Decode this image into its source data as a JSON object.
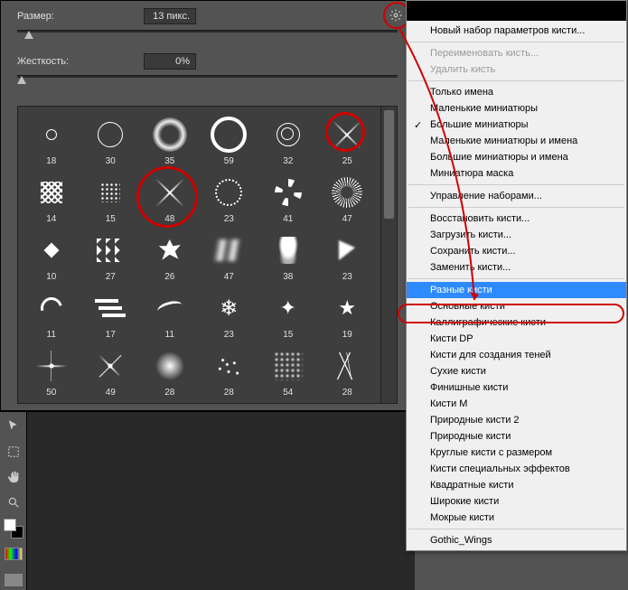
{
  "controls": {
    "size_label": "Размер:",
    "size_value": "13 пикс.",
    "hardness_label": "Жесткость:",
    "hardness_value": "0%"
  },
  "brushes": [
    {
      "n": "18",
      "t": "ring-s"
    },
    {
      "n": "30",
      "t": "ring-m"
    },
    {
      "n": "35",
      "t": "soft-ring"
    },
    {
      "n": "59",
      "t": "ring-thick"
    },
    {
      "n": "32",
      "t": "ring-double"
    },
    {
      "n": "25",
      "t": "cross"
    },
    {
      "n": "14",
      "t": "hatch"
    },
    {
      "n": "15",
      "t": "grid"
    },
    {
      "n": "48",
      "t": "cross"
    },
    {
      "n": "23",
      "t": "dotted-ring"
    },
    {
      "n": "41",
      "t": "swirl"
    },
    {
      "n": "47",
      "t": "burst"
    },
    {
      "n": "10",
      "t": "diamond"
    },
    {
      "n": "27",
      "t": "zigzag"
    },
    {
      "n": "26",
      "t": "splat"
    },
    {
      "n": "47",
      "t": "blur-z"
    },
    {
      "n": "38",
      "t": "blob"
    },
    {
      "n": "23",
      "t": "tri"
    },
    {
      "n": "11",
      "t": "curl"
    },
    {
      "n": "17",
      "t": "dash3"
    },
    {
      "n": "11",
      "t": "squig"
    },
    {
      "n": "23",
      "t": "snow"
    },
    {
      "n": "15",
      "t": "star"
    },
    {
      "n": "19",
      "t": "star5"
    },
    {
      "n": "50",
      "t": "sparkle"
    },
    {
      "n": "49",
      "t": "sparkle-d"
    },
    {
      "n": "28",
      "t": "fuzz"
    },
    {
      "n": "28",
      "t": "grain"
    },
    {
      "n": "54",
      "t": "dust"
    },
    {
      "n": "28",
      "t": "scratch"
    }
  ],
  "menu": {
    "new_preset": "Новый набор параметров кисти...",
    "rename": "Переименовать кисть...",
    "delete": "Удалить кисть",
    "names_only": "Только имена",
    "small_thumb": "Маленькие миниатюры",
    "large_thumb": "Большие миниатюры",
    "small_thumb_names": "Маленькие миниатюры и имена",
    "large_thumb_names": "Большие миниатюры и имена",
    "mask_thumb": "Миниатюра маска",
    "preset_manager": "Управление наборами...",
    "restore": "Восстановить кисти...",
    "load": "Загрузить кисти...",
    "save": "Сохранить кисти...",
    "replace": "Заменить кисти...",
    "assorted": "Разные кисти",
    "basic": "Основные кисти",
    "calligraphic": "Каллиграфические кисти",
    "dp": "Кисти DP",
    "shadow": "Кисти для создания теней",
    "dry": "Сухие кисти",
    "finish": "Финишные кисти",
    "m": "Кисти M",
    "natural2": "Природные кисти 2",
    "natural": "Природные кисти",
    "round_size": "Круглые кисти с размером",
    "special": "Кисти специальных эффектов",
    "square": "Квадратные кисти",
    "wide": "Широкие кисти",
    "wet": "Мокрые кисти",
    "gothic": "Gothic_Wings"
  },
  "annotations": {
    "circ_25": 5,
    "circ_48": 8,
    "gear": true,
    "arrow_to": "assorted",
    "oval_on": "assorted"
  },
  "colors": {
    "highlight": "#2e8bff",
    "anno": "#d00000"
  }
}
